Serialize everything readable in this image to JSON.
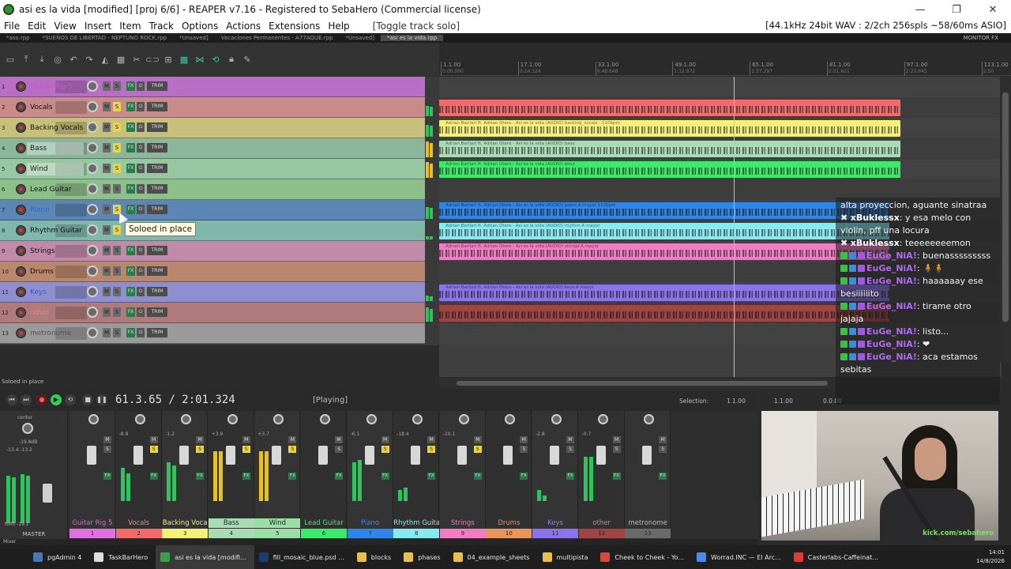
{
  "window": {
    "title": "asi es la vida [modified] [proj 6/6] - REAPER v7.16 - Registered to SebaHero (Commercial license)",
    "minimize": "—",
    "maximize": "❐",
    "close": "✕"
  },
  "menu": {
    "items": [
      "File",
      "Edit",
      "View",
      "Insert",
      "Item",
      "Track",
      "Options",
      "Actions",
      "Extensions",
      "Help"
    ],
    "toggle_hint": "[Toggle track solo]",
    "audio_status": "[44.1kHz 24bit WAV : 2/2ch 256spls ~58/60ms ASIO]"
  },
  "project_tabs": [
    {
      "label": "*aso.rpp"
    },
    {
      "label": "*SUEÑOS DE LIBERTAD - NEPTUNO ROCK.rpp"
    },
    {
      "label": "*Unsaved]"
    },
    {
      "label": "Vacaciones Permanentes - A77AQUE.rpp"
    },
    {
      "label": "*Unsaved]"
    },
    {
      "label": "*asi es la vida.rpp"
    }
  ],
  "monitor_fx": "MONITOR FX",
  "ruler": [
    {
      "label": "1.1.00",
      "time": "0:00.000"
    },
    {
      "label": "17.1.00",
      "time": "0:24.324"
    },
    {
      "label": "33.1.00",
      "time": "0:48.648"
    },
    {
      "label": "49.1.00",
      "time": "1:12.972"
    },
    {
      "label": "65.1.00",
      "time": "1:37.297"
    },
    {
      "label": "81.1.00",
      "time": "2:01.621"
    },
    {
      "label": "97.1.00",
      "time": "2:25.945"
    },
    {
      "label": "113.1.00",
      "time": "2:50"
    }
  ],
  "tracks": [
    {
      "num": "1",
      "name": "Guitar Rig 5",
      "color": "#b86ec4",
      "name_color": "#d64ad6",
      "solo": false
    },
    {
      "num": "2",
      "name": "Vocals",
      "color": "#c98a8a",
      "name_color": "#111111",
      "solo": true
    },
    {
      "num": "3",
      "name": "Backing Vocals",
      "color": "#c6c07a",
      "name_color": "#111111",
      "solo": true
    },
    {
      "num": "4",
      "name": "Bass",
      "color": "#8cb69a",
      "name_color": "#222222",
      "solo": true
    },
    {
      "num": "5",
      "name": "Wind",
      "color": "#95c8a0",
      "name_color": "#222222",
      "solo": true
    },
    {
      "num": "6",
      "name": "Lead Guitar",
      "color": "#8dbf8a",
      "name_color": "#111111",
      "solo": false
    },
    {
      "num": "7",
      "name": "Piano",
      "color": "#5b86b5",
      "name_color": "#2a6adf",
      "solo": true
    },
    {
      "num": "8",
      "name": "Rhythm Guitar",
      "color": "#7fb8ab",
      "name_color": "#111111",
      "solo": true
    },
    {
      "num": "9",
      "name": "Strings",
      "color": "#c08aa8",
      "name_color": "#111111",
      "solo": false
    },
    {
      "num": "10",
      "name": "Drums",
      "color": "#b8876e",
      "name_color": "#111111",
      "solo": false
    },
    {
      "num": "11",
      "name": "Keys",
      "color": "#8e8ed0",
      "name_color": "#2a5ad8",
      "solo": false
    },
    {
      "num": "12",
      "name": "other",
      "color": "#b17a7a",
      "name_color": "#d68a8a",
      "solo": false
    },
    {
      "num": "13",
      "name": "metronome",
      "color": "#9a9a9a",
      "name_color": "#555555",
      "solo": false
    }
  ],
  "track_buttons": {
    "mute": "M",
    "solo": "S",
    "fx": "FX",
    "io": "⏻",
    "trim": "TRIM"
  },
  "tooltip": "Soloed in place",
  "items": [
    {
      "lane": 1,
      "color": "#f26a6a",
      "label": "",
      "fraction_end": 0.82
    },
    {
      "lane": 2,
      "color": "#f4f07a",
      "label": "Adrian Barilari ft. Adrian Otero - Asi es la vida (AUDIO) backing_vocals - 110bpm",
      "fraction_end": 0.82
    },
    {
      "lane": 3,
      "color": "#a8dcb4",
      "label": "Adrian Barilari ft. Adrian Otero - Asi es la vida (AUDIO) bass",
      "fraction_end": 0.82
    },
    {
      "lane": 4,
      "color": "#3cea6a",
      "label": "Adrian Barilari ft. Adrian Otero - Asi es la vida (AUDIO) wind",
      "fraction_end": 0.82
    },
    {
      "lane": 6,
      "color": "#2f86e8",
      "label": "Adrian Barilari ft. Adrian Otero - Asi es la vida (AUDIO) piano A mayor 110bpm",
      "fraction_end": 0.8
    },
    {
      "lane": 7,
      "color": "#86eaf0",
      "label": "Adrian Barilari ft. Adrian Otero - Asi es la vida (AUDIO) rhythm A mayor",
      "fraction_end": 0.8
    },
    {
      "lane": 8,
      "color": "#f27cc2",
      "label": "Adrian Barilari ft. Adrian Otero - Asi es la vida (AUDIO) strings A mayor",
      "fraction_end": 0.8
    },
    {
      "lane": 10,
      "color": "#8a74ec",
      "label": "Adrian Barilari ft. Adrian Otero - Asi es la vida (AUDIO) keys A mayor",
      "fraction_end": 0.8
    },
    {
      "lane": 11,
      "color": "#a04444",
      "label": "",
      "fraction_end": 0.8
    }
  ],
  "status_left": "Soloed in place",
  "transport": {
    "timecode": "61.3.65 / 2:01.324",
    "state": "[Playing]",
    "selection_label": "Selection:",
    "selection_start": "1.1.00",
    "selection_end": "1.1.00",
    "selection_length": "0.0.00"
  },
  "master": {
    "label": "MASTER",
    "pan": "center",
    "db": "-19.8dB",
    "db2": "-13.4   -13.2",
    "rms": "RMS   -19.1"
  },
  "mixer_label": "Mixer",
  "mixer_strips": [
    {
      "name": "Guitar Rig 5",
      "num": "1",
      "color": "#e070e0",
      "name_color": "#e060e0",
      "peak": "",
      "level_l": 0.0,
      "level_r": 0.0
    },
    {
      "name": "Vocals",
      "num": "2",
      "color": "#f26a6a",
      "name_color": "#f28a8a",
      "peak": "-8.8",
      "level_l": 0.6,
      "level_r": 0.5
    },
    {
      "name": "Backing Voca",
      "num": "3",
      "color": "#f4f07a",
      "name_color": "#f4f07a",
      "peak": "-1.2",
      "level_l": 0.7,
      "level_r": 0.65
    },
    {
      "name": "Bass",
      "num": "4",
      "color": "#a8dcb4",
      "name_color": "#222222",
      "peak": "+3.9",
      "level_l": 0.9,
      "level_r": 0.9
    },
    {
      "name": "Wind",
      "num": "5",
      "color": "#9ae0a6",
      "name_color": "#222222",
      "peak": "+3.7",
      "level_l": 0.9,
      "level_r": 0.9
    },
    {
      "name": "Lead Guitar",
      "num": "6",
      "color": "#3cea6a",
      "name_color": "#3cea6a",
      "peak": "",
      "level_l": 0.0,
      "level_r": 0.0
    },
    {
      "name": "Piano",
      "num": "7",
      "color": "#2f86e8",
      "name_color": "#3a8aff",
      "peak": "-6.1",
      "level_l": 0.7,
      "level_r": 0.75
    },
    {
      "name": "Rhythm Guita",
      "num": "8",
      "color": "#86eaf0",
      "name_color": "#86eaf0",
      "peak": "-18.4",
      "level_l": 0.2,
      "level_r": 0.25
    },
    {
      "name": "Strings",
      "num": "9",
      "color": "#f27cc2",
      "name_color": "#f27cc2",
      "peak": "-10.1",
      "level_l": 0.0,
      "level_r": 0.0
    },
    {
      "name": "Drums",
      "num": "10",
      "color": "#e8945a",
      "name_color": "#f28a5a",
      "peak": "",
      "level_l": 0.0,
      "level_r": 0.0
    },
    {
      "name": "Keys",
      "num": "11",
      "color": "#8a74ec",
      "name_color": "#7a8aff",
      "peak": "-2.8",
      "level_l": 0.2,
      "level_r": 0.1
    },
    {
      "name": "other",
      "num": "12",
      "color": "#a04444",
      "name_color": "#c08a8a",
      "peak": "-0.7",
      "level_l": 0.8,
      "level_r": 0.8
    },
    {
      "name": "metronome",
      "num": "13",
      "color": "#6a6a6a",
      "name_color": "#bbbbbb",
      "peak": "",
      "level_l": 0.0,
      "level_r": 0.0
    }
  ],
  "chat": [
    {
      "user": "",
      "text": "alta proyeccion, aguante sinatraa",
      "type": "text"
    },
    {
      "user": "xBuklessx",
      "text": ": y esa melo con violin, pff una locura",
      "type": "k"
    },
    {
      "user": "xBuklessx",
      "text": ": teeeeeeeemon",
      "type": "k"
    },
    {
      "user": "EuGe_NiA!",
      "text": ": buenasssssssss",
      "type": "e"
    },
    {
      "user": "EuGe_NiA!",
      "text": ": 🧍🧍",
      "type": "e"
    },
    {
      "user": "EuGe_NiA!",
      "text": ": haaaaaay ese besiiiiiito",
      "type": "e"
    },
    {
      "user": "EuGe_NiA!",
      "text": ": tirame otro jajaja",
      "type": "e"
    },
    {
      "user": "EuGe_NiA!",
      "text": ": listo...",
      "type": "e"
    },
    {
      "user": "EuGe_NiA!",
      "text": ": ❤",
      "type": "e"
    },
    {
      "user": "EuGe_NiA!",
      "text": ": aca estamos sebitas",
      "type": "e"
    }
  ],
  "webcam_watermark": "kick.com/sebahero",
  "taskbar": [
    {
      "label": "pgAdmin 4",
      "icon_color": "#4a78b0",
      "active": false
    },
    {
      "label": "TaskBarHero",
      "icon_color": "#dddddd",
      "active": false
    },
    {
      "label": "asi es la vida [modifi...",
      "icon_color": "#3aa04a",
      "active": true
    },
    {
      "label": "fill_mosaic_blue.psd ...",
      "icon_color": "#1e3a6e",
      "active": false
    },
    {
      "label": "blocks",
      "icon_color": "#e8c04a",
      "active": false
    },
    {
      "label": "phases",
      "icon_color": "#e8c04a",
      "active": false
    },
    {
      "label": "04_example_sheets",
      "icon_color": "#e8c04a",
      "active": false
    },
    {
      "label": "multipista",
      "icon_color": "#e8c04a",
      "active": false
    },
    {
      "label": "Cheek to Cheek - Yo...",
      "icon_color": "#d24a3a",
      "active": false
    },
    {
      "label": "Worrad.INC — El Arc...",
      "icon_color": "#4a8ae8",
      "active": false
    },
    {
      "label": "Casterlabs-Caffeinat...",
      "icon_color": "#e23a3a",
      "active": false
    }
  ],
  "clock": {
    "time": "14:01",
    "date": "14/8/2026"
  }
}
